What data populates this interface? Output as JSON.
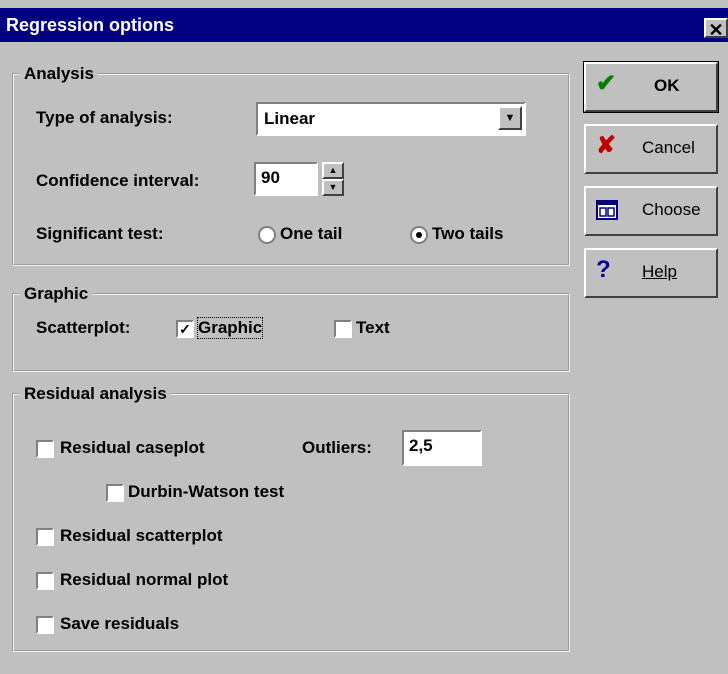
{
  "window": {
    "title": "Regression options",
    "close": "✕"
  },
  "analysis": {
    "legend": "Analysis",
    "type_label": "Type of analysis:",
    "type_value": "Linear",
    "ci_label": "Confidence interval:",
    "ci_value": "90",
    "sig_label": "Significant test:",
    "one_tail": "One tail",
    "two_tails": "Two tails",
    "selected_tail": "Two tails"
  },
  "graphic": {
    "legend": "Graphic",
    "scatter_label": "Scatterplot:",
    "graphic_option": "Graphic",
    "graphic_checked": true,
    "text_option": "Text",
    "text_checked": false
  },
  "residual": {
    "legend": "Residual analysis",
    "caseplot": "Residual caseplot",
    "outliers_label": "Outliers:",
    "outliers_value": "2,5",
    "durbin": "Durbin-Watson test",
    "scatterplot": "Residual scatterplot",
    "normal_plot": "Residual normal plot",
    "save": "Save residuals"
  },
  "buttons": {
    "ok": "OK",
    "cancel": "Cancel",
    "choose": "Choose",
    "help": "Help"
  },
  "icons": {
    "ok": "check-icon",
    "cancel": "x-icon",
    "choose": "window-icon",
    "help": "question-icon"
  },
  "colors": {
    "titlebar": "#000080",
    "ok_icon": "#008000",
    "cancel_icon": "#c00000",
    "help_icon": "#0000a0"
  }
}
